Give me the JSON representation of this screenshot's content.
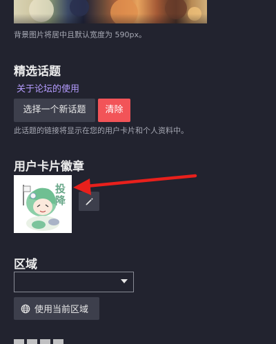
{
  "profile_background": {
    "hint": "背景图片将居中且默认宽度为 590px。"
  },
  "featured_topic": {
    "title": "精选话题",
    "topic_link": "关于论坛的使用",
    "select_button": "选择一个新话题",
    "clear_button": "清除",
    "hint": "此话题的链接将显示在您的用户卡片和个人资料中。"
  },
  "card_badge": {
    "title": "用户卡片徽章",
    "badge_text": "投降",
    "edit_icon": "pencil-icon"
  },
  "location": {
    "title": "区域",
    "select_value": "",
    "use_current_button": "使用当前区域",
    "button_icon": "globe-icon"
  },
  "annotation": {
    "arrow_color": "#e8201c"
  },
  "colors": {
    "background": "#22232f",
    "button": "#3d3f4c",
    "danger": "#f25458",
    "link": "#b59cff"
  }
}
